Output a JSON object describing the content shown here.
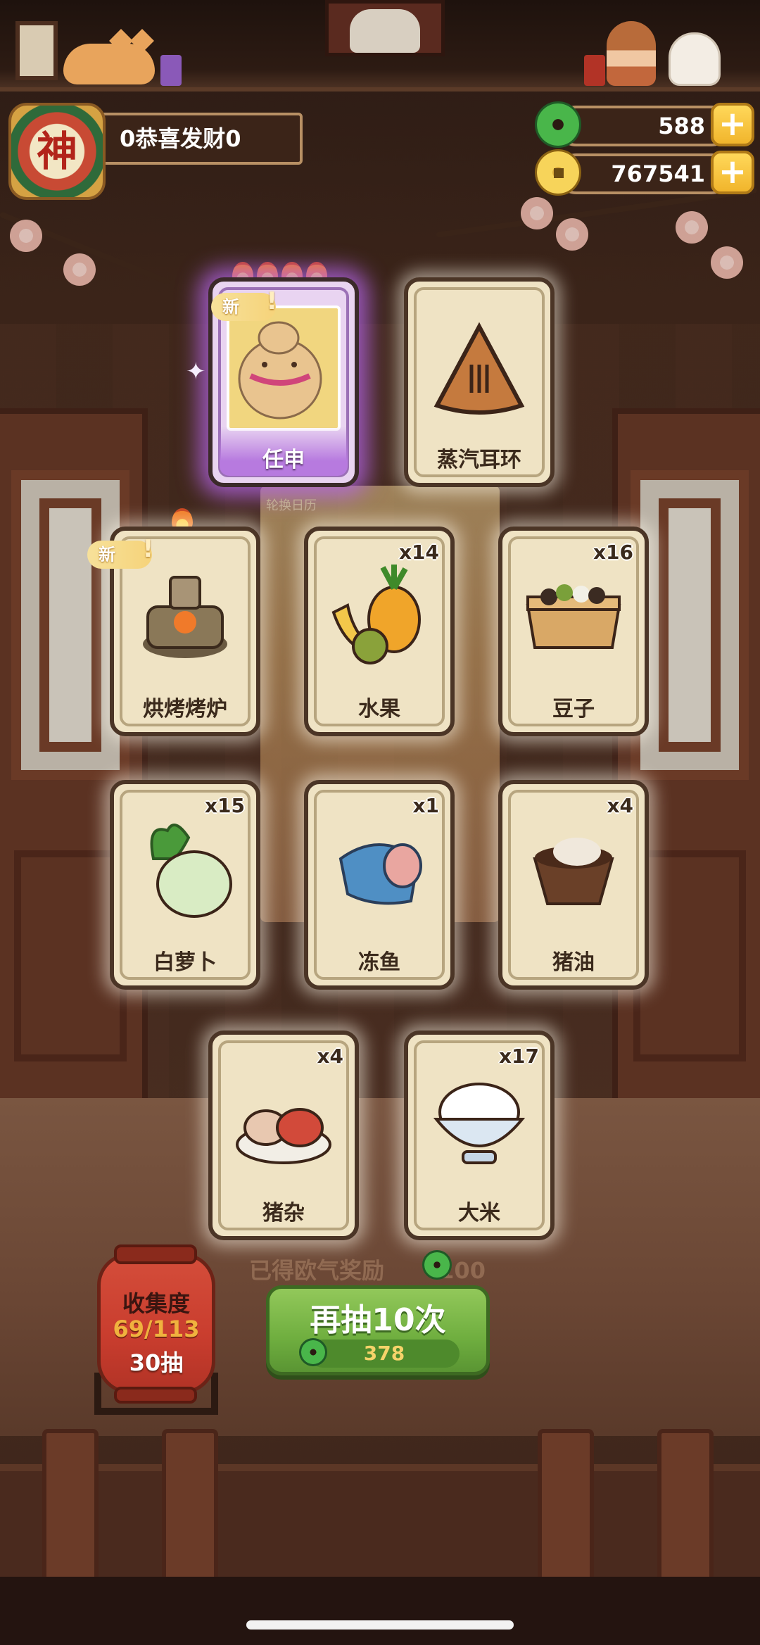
{
  "player": {
    "badge_char": "神",
    "name": "0恭喜发财0"
  },
  "currencies": [
    {
      "icon": "jade-coin-icon",
      "value": "588"
    },
    {
      "icon": "gold-coin-icon",
      "value": "767541"
    }
  ],
  "rewards": [
    {
      "label": "任申",
      "count": "",
      "is_new": true,
      "rarity": "purple",
      "flames": 4
    },
    {
      "label": "蒸汽耳环",
      "count": "",
      "is_new": false,
      "rarity": "normal",
      "flames": 0
    },
    {
      "label": "烘烤烤炉",
      "count": "",
      "is_new": true,
      "rarity": "normal",
      "flames": 1
    },
    {
      "label": "水果",
      "count": "x14",
      "is_new": false,
      "rarity": "normal",
      "flames": 0
    },
    {
      "label": "豆子",
      "count": "x16",
      "is_new": false,
      "rarity": "normal",
      "flames": 0
    },
    {
      "label": "白萝卜",
      "count": "x15",
      "is_new": false,
      "rarity": "normal",
      "flames": 0
    },
    {
      "label": "冻鱼",
      "count": "x1",
      "is_new": false,
      "rarity": "normal",
      "flames": 0
    },
    {
      "label": "猪油",
      "count": "x4",
      "is_new": false,
      "rarity": "normal",
      "flames": 0
    },
    {
      "label": "猪杂",
      "count": "x4",
      "is_new": false,
      "rarity": "normal",
      "flames": 0
    },
    {
      "label": "大米",
      "count": "x17",
      "is_new": false,
      "rarity": "normal",
      "flames": 0
    }
  ],
  "new_tag": "新",
  "new_bang": "!",
  "sub_note": "轮换日历",
  "luck_text": "已得欧气奖励",
  "luck_value": "100",
  "collection": {
    "title": "收集度",
    "progress": "69/113",
    "draws": "30抽"
  },
  "draw_button": {
    "label": "再抽10次",
    "cost": "378"
  },
  "colors": {
    "accent_green": "#6fae3f",
    "gold": "#f1b52c",
    "lantern_red": "#c93d2e",
    "purple_glow": "#b77adf"
  }
}
